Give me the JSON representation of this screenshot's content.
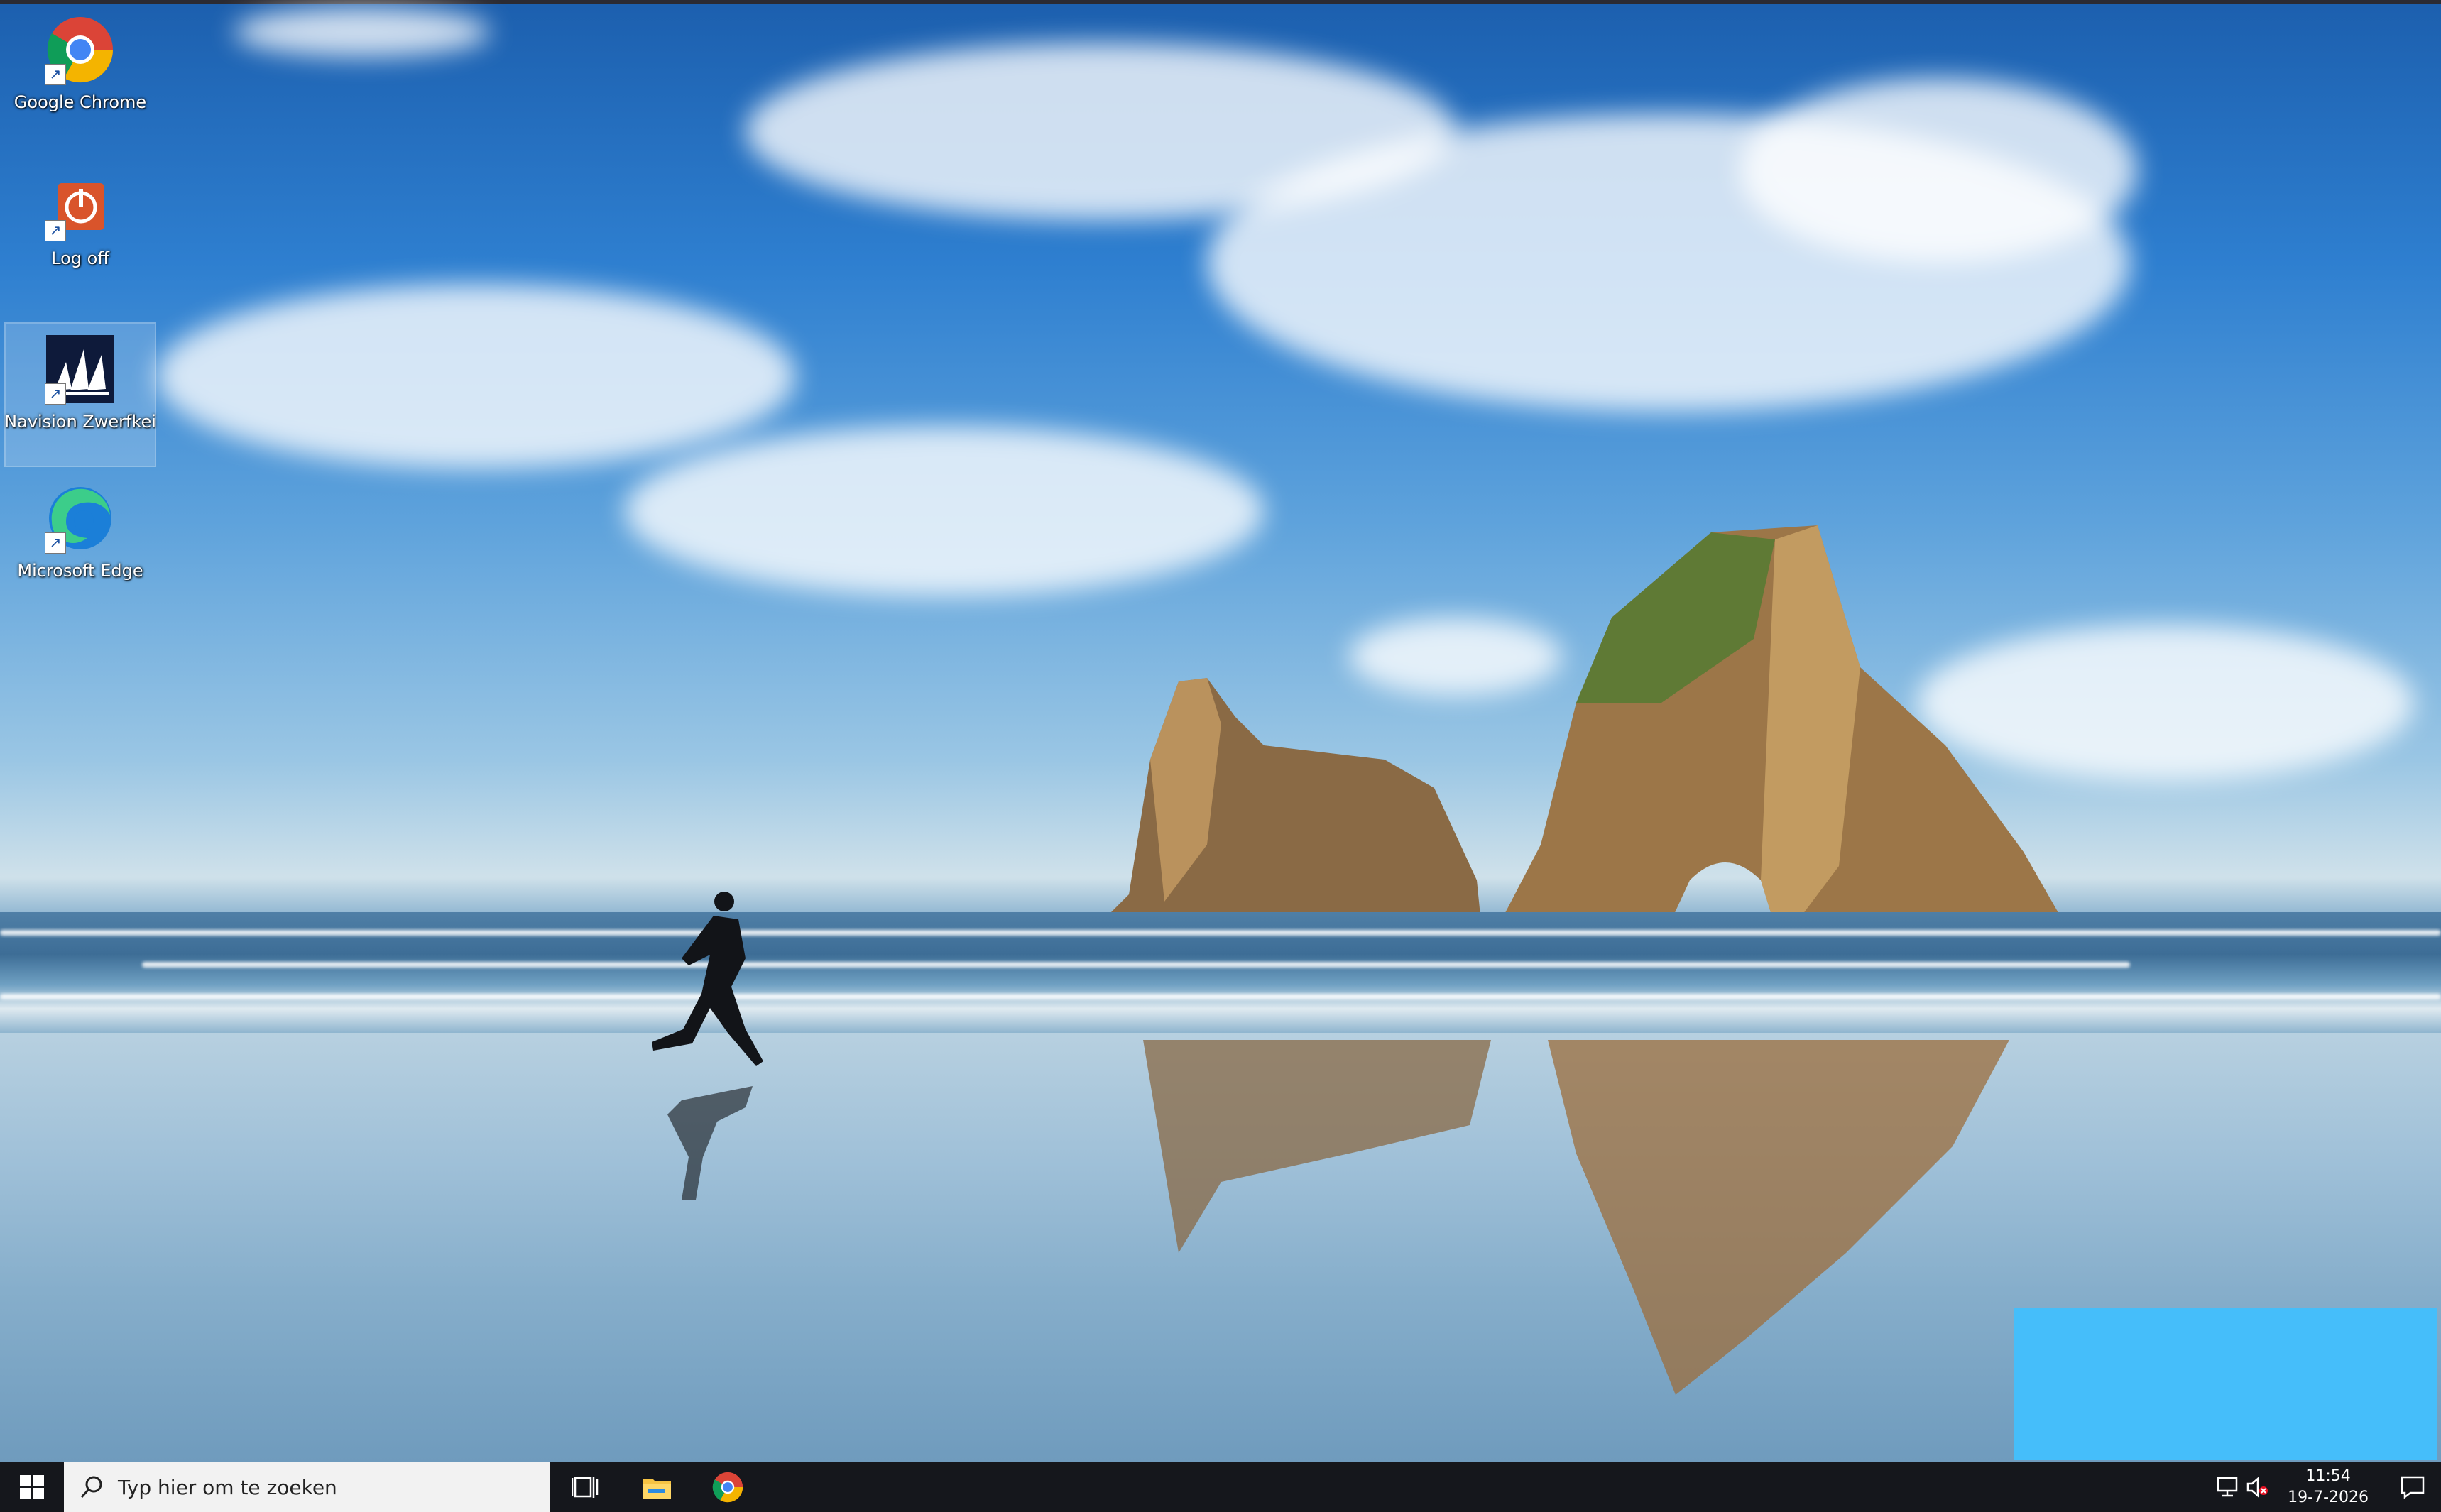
{
  "desktop": {
    "icons": [
      {
        "label": "Google Chrome",
        "icon": "chrome-icon"
      },
      {
        "label": "Log off",
        "icon": "log-off-icon"
      },
      {
        "label": "Navision Zwerfkei",
        "icon": "navision-icon"
      },
      {
        "label": "Microsoft Edge",
        "icon": "edge-icon"
      }
    ]
  },
  "taskbar": {
    "start_icon": "windows-start-icon",
    "search_placeholder": "Typ hier om te zoeken",
    "pinned": [
      "task-view-icon",
      "file-explorer-icon",
      "chrome-icon"
    ],
    "tray": {
      "time": "11:54",
      "date": "19-7-2026",
      "icons": [
        "network-icon",
        "volume-muted-icon",
        "notification-icon"
      ]
    }
  },
  "colors": {
    "taskbar_bg": "#15171c",
    "search_bg": "#f2f2f2",
    "overlay_rect": "#45befa"
  }
}
